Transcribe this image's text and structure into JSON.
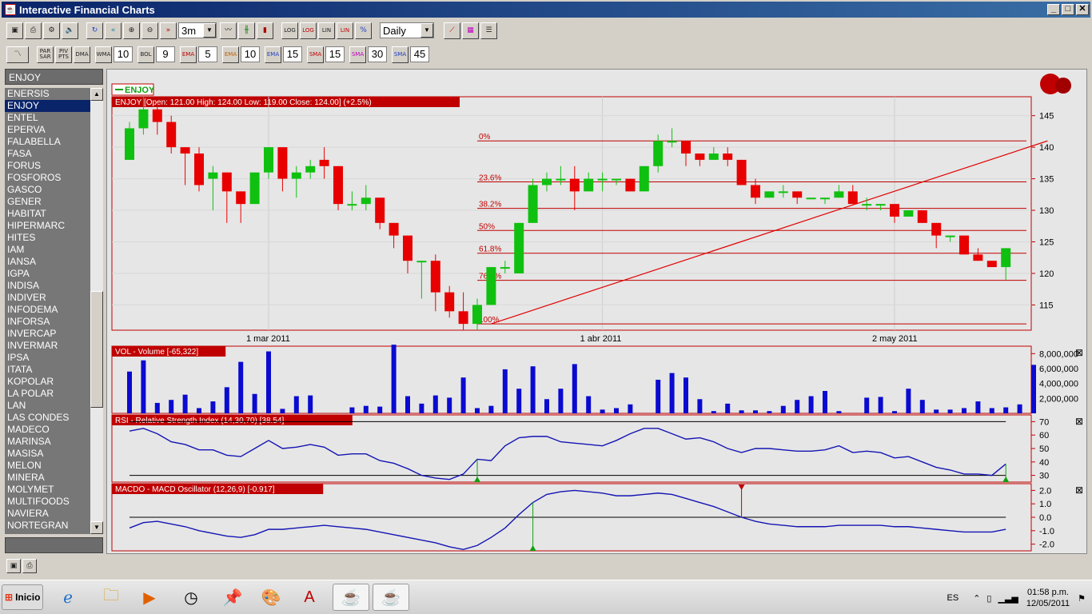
{
  "window": {
    "title": "Interactive Financial Charts"
  },
  "toolbar1": {
    "period": "3m",
    "interval": "Daily",
    "btn_log1": "LOG",
    "btn_log2": "LOG",
    "btn_lin1": "LIN",
    "btn_lin2": "LIN",
    "btn_pct": "%"
  },
  "toolbar2": {
    "par": "PAR SAR",
    "piv": "PIV PTS",
    "dma": "DMA",
    "wma": "WMA",
    "wma_v": "10",
    "bol": "BOL",
    "bol_v": "9",
    "ema1": "EMA",
    "ema1_v": "5",
    "ema2": "EMA",
    "ema2_v": "10",
    "ema3": "EMA",
    "ema3_v": "15",
    "sma1": "SMA",
    "sma1_v": "15",
    "sma2": "SMA",
    "sma2_v": "30",
    "sma3": "SMA",
    "sma3_v": "45"
  },
  "sidebar": {
    "header": "ENJOY",
    "items": [
      "ENERSIS",
      "ENJOY",
      "ENTEL",
      "EPERVA",
      "FALABELLA",
      "FASA",
      "FORUS",
      "FOSFOROS",
      "GASCO",
      "GENER",
      "HABITAT",
      "HIPERMARC",
      "HITES",
      "IAM",
      "IANSA",
      "IGPA",
      "INDISA",
      "INDIVER",
      "INFODEMA",
      "INFORSA",
      "INVERCAP",
      "INVERMAR",
      "IPSA",
      "ITATA",
      "KOPOLAR",
      "LA POLAR",
      "LAN",
      "LAS CONDES",
      "MADECO",
      "MARINSA",
      "MASISA",
      "MELON",
      "MINERA",
      "MOLYMET",
      "MULTIFOODS",
      "NAVIERA",
      "NORTEGRAN"
    ],
    "selected": 1
  },
  "chart_data": [
    {
      "type": "candlestick",
      "legend": "ENJOY",
      "title": "ENJOY [Open: 121.00  High: 124.00  Low: 119.00  Close: 124.00] (+2.5%)",
      "ylim": [
        111,
        148
      ],
      "yticks": [
        115,
        120,
        125,
        130,
        135,
        140,
        145
      ],
      "xticks": [
        {
          "i": 10,
          "label": "1 mar 2011"
        },
        {
          "i": 34,
          "label": "1 abr 2011"
        },
        {
          "i": 55,
          "label": "2 may 2011"
        }
      ],
      "fibonacci": [
        {
          "label": "0%",
          "value": 141.0
        },
        {
          "label": "23.6%",
          "value": 134.5
        },
        {
          "label": "38.2%",
          "value": 130.3
        },
        {
          "label": "50%",
          "value": 126.8
        },
        {
          "label": "61.8%",
          "value": 123.2
        },
        {
          "label": "76.4%",
          "value": 118.9
        },
        {
          "label": "100%",
          "value": 112.0
        }
      ],
      "trendline": {
        "from": [
          26,
          112.0
        ],
        "to": [
          66,
          141.0
        ]
      },
      "candles": [
        [
          138,
          143,
          138,
          144
        ],
        [
          143,
          146,
          142,
          148
        ],
        [
          146,
          144,
          142,
          147
        ],
        [
          144,
          140,
          139,
          145
        ],
        [
          140,
          139,
          134,
          140
        ],
        [
          139,
          134,
          133,
          140
        ],
        [
          135,
          136,
          130,
          137
        ],
        [
          136,
          133,
          128,
          136
        ],
        [
          133,
          131,
          128,
          133
        ],
        [
          131,
          136,
          131,
          136
        ],
        [
          136,
          140,
          135,
          140
        ],
        [
          140,
          135,
          133,
          140
        ],
        [
          135,
          136,
          132,
          137
        ],
        [
          136,
          137,
          135,
          138
        ],
        [
          138,
          137,
          135,
          140
        ],
        [
          137,
          131,
          130,
          137
        ],
        [
          131,
          131,
          130,
          133
        ],
        [
          131,
          132,
          130,
          134
        ],
        [
          132,
          128,
          127,
          132
        ],
        [
          128,
          126,
          124,
          128
        ],
        [
          126,
          122,
          120,
          126
        ],
        [
          122,
          122,
          116,
          122
        ],
        [
          122,
          117,
          114,
          123
        ],
        [
          117,
          114,
          113,
          118
        ],
        [
          114,
          112,
          111,
          117
        ],
        [
          112,
          115,
          111,
          116
        ],
        [
          115,
          121,
          115,
          121
        ],
        [
          121,
          121,
          120,
          122
        ],
        [
          120,
          128,
          120,
          128
        ],
        [
          128,
          134,
          128,
          135
        ],
        [
          134,
          135,
          133,
          136
        ],
        [
          135,
          135,
          134,
          137
        ],
        [
          135,
          133,
          130,
          137
        ],
        [
          133,
          135,
          133,
          136
        ],
        [
          135,
          135,
          133,
          136
        ],
        [
          135,
          135,
          134,
          135
        ],
        [
          135,
          133,
          133,
          135
        ],
        [
          133,
          137,
          133,
          137
        ],
        [
          137,
          141,
          136,
          142
        ],
        [
          141,
          141,
          140,
          143
        ],
        [
          141,
          139,
          137,
          141
        ],
        [
          139,
          138,
          137,
          139
        ],
        [
          138,
          139,
          138,
          140
        ],
        [
          139,
          138,
          137,
          140
        ],
        [
          138,
          134,
          134,
          138
        ],
        [
          134,
          132,
          131,
          135
        ],
        [
          132,
          133,
          132,
          133
        ],
        [
          133,
          133,
          132,
          134
        ],
        [
          133,
          132,
          131,
          133
        ],
        [
          132,
          132,
          132,
          132
        ],
        [
          132,
          132,
          131,
          132
        ],
        [
          132,
          133,
          132,
          134
        ],
        [
          133,
          131,
          131,
          134
        ],
        [
          131,
          131,
          130,
          132
        ],
        [
          131,
          131,
          130,
          131
        ],
        [
          131,
          129,
          128,
          131
        ],
        [
          129,
          130,
          129,
          130
        ],
        [
          130,
          128,
          128,
          130
        ],
        [
          128,
          126,
          124,
          128
        ],
        [
          126,
          126,
          125,
          126
        ],
        [
          126,
          123,
          123,
          126
        ],
        [
          123,
          122,
          122,
          124
        ],
        [
          122,
          121,
          121,
          122
        ],
        [
          121,
          124,
          119,
          124
        ]
      ]
    },
    {
      "type": "bar",
      "title": "VOL - Volume [-65,322]",
      "ylim": [
        0,
        9000000
      ],
      "yticks": [
        {
          "v": 2000000,
          "label": "2,000,000"
        },
        {
          "v": 4000000,
          "label": "4,000,000"
        },
        {
          "v": 6000000,
          "label": "6,000,000"
        },
        {
          "v": 8000000,
          "label": "8,000,000"
        }
      ],
      "values": [
        5600000,
        7100000,
        1400000,
        1800000,
        2500000,
        700000,
        1600000,
        3500000,
        6900000,
        2600000,
        8300000,
        600000,
        2300000,
        2400000,
        0,
        0,
        800000,
        1000000,
        900000,
        9200000,
        2300000,
        1300000,
        2400000,
        2100000,
        4800000,
        700000,
        1000000,
        5900000,
        3300000,
        6300000,
        1900000,
        3300000,
        6600000,
        2300000,
        500000,
        700000,
        1200000,
        0,
        4500000,
        5400000,
        4800000,
        1900000,
        300000,
        1300000,
        400000,
        400000,
        300000,
        1000000,
        1800000,
        2300000,
        3000000,
        300000,
        0,
        2100000,
        2200000,
        300000,
        3300000,
        1800000,
        500000,
        500000,
        700000,
        1600000,
        700000,
        800000,
        1200000,
        6500000
      ]
    },
    {
      "type": "line",
      "title": "RSI - Relative Strength Index (14,30,70) [38.54]",
      "ylim": [
        25,
        75
      ],
      "yticks": [
        30,
        40,
        50,
        60,
        70
      ],
      "bands": [
        30,
        70
      ],
      "values": [
        63,
        65,
        61,
        55,
        53,
        49,
        49,
        45,
        44,
        50,
        56,
        50,
        51,
        53,
        51,
        45,
        46,
        46,
        41,
        39,
        35,
        30,
        28,
        27,
        31,
        42,
        41,
        52,
        58,
        59,
        59,
        55,
        54,
        53,
        52,
        56,
        61,
        65,
        65,
        61,
        57,
        58,
        55,
        50,
        47,
        50,
        50,
        49,
        48,
        48,
        49,
        52,
        47,
        48,
        47,
        43,
        44,
        40,
        36,
        34,
        31,
        31,
        30,
        38.5
      ],
      "signals": [
        {
          "i": 25,
          "dir": "up"
        },
        {
          "i": 63,
          "dir": "up"
        }
      ]
    },
    {
      "type": "line",
      "title": "MACDO - MACD Oscillator (12,26,9) [-0.917]",
      "ylim": [
        -2.5,
        2.5
      ],
      "yticks": [
        {
          "v": -2.0,
          "label": "-2.0"
        },
        {
          "v": -1.0,
          "label": "-1.0"
        },
        {
          "v": 0.0,
          "label": "0.0"
        },
        {
          "v": 1.0,
          "label": "1.0"
        },
        {
          "v": 2.0,
          "label": "2.0"
        }
      ],
      "values": [
        -0.8,
        -0.4,
        -0.3,
        -0.5,
        -0.7,
        -1.0,
        -1.2,
        -1.4,
        -1.5,
        -1.3,
        -0.9,
        -0.9,
        -0.8,
        -0.7,
        -0.6,
        -0.7,
        -0.8,
        -0.9,
        -1.1,
        -1.3,
        -1.5,
        -1.7,
        -1.9,
        -2.2,
        -2.4,
        -2.1,
        -1.5,
        -0.8,
        0.2,
        1.1,
        1.7,
        1.9,
        2.0,
        1.9,
        1.8,
        1.6,
        1.6,
        1.7,
        1.8,
        1.7,
        1.4,
        1.1,
        0.8,
        0.4,
        0.0,
        -0.3,
        -0.5,
        -0.6,
        -0.7,
        -0.7,
        -0.7,
        -0.6,
        -0.6,
        -0.6,
        -0.6,
        -0.7,
        -0.7,
        -0.8,
        -0.9,
        -1.0,
        -1.1,
        -1.1,
        -1.1,
        -0.9
      ],
      "signals": [
        {
          "i": 29,
          "dir": "up"
        },
        {
          "i": 44,
          "dir": "down"
        }
      ]
    }
  ],
  "taskbar": {
    "start": "Inicio",
    "lang": "ES",
    "time": "01:58 p.m.",
    "date": "12/05/2011"
  },
  "colors": {
    "up": "#10c010",
    "down": "#e80000",
    "line": "#1414b4",
    "frame": "#c00000",
    "vol": "#0a0ad0"
  }
}
